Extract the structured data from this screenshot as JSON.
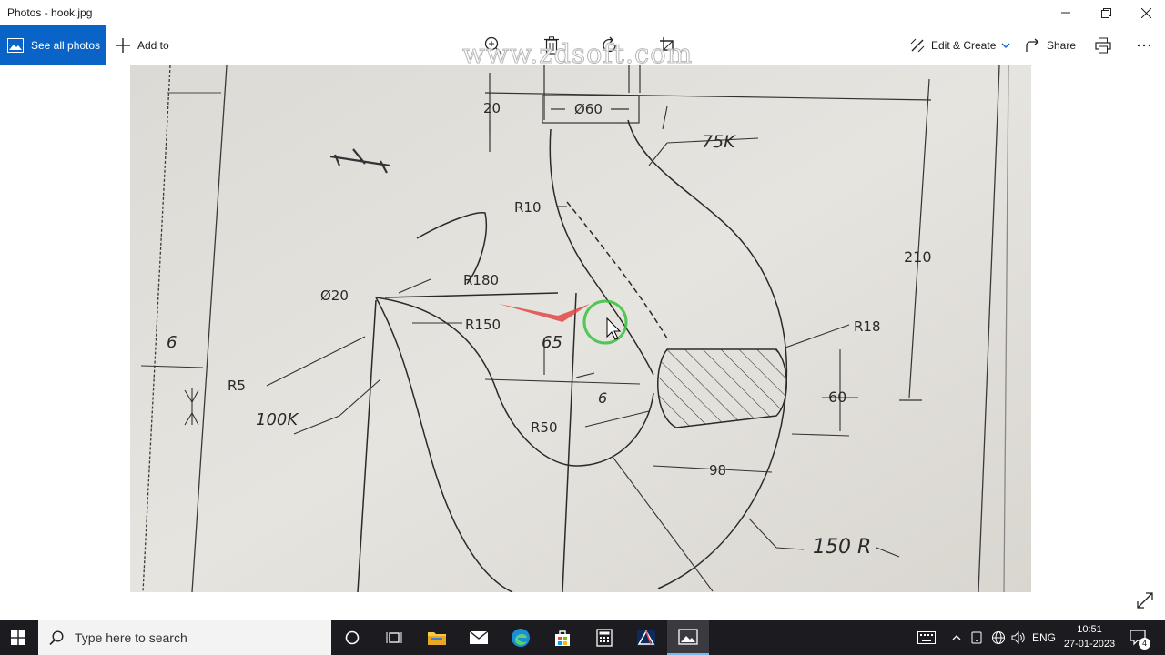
{
  "window": {
    "title": "Photos - hook.jpg",
    "minimize_icon": "minimize-icon",
    "maximize_icon": "restore-icon",
    "close_icon": "close-icon"
  },
  "toolbar": {
    "see_all_label": "See all photos",
    "add_to_label": "Add to",
    "edit_create_label": "Edit & Create",
    "share_label": "Share",
    "watermark": "www.zdsoft.com",
    "center_icons": [
      "zoom-in-icon",
      "delete-icon",
      "rotate-icon",
      "crop-icon"
    ]
  },
  "drawing": {
    "labels": {
      "d20": "20",
      "dia60": "Ø60",
      "r75": "75K",
      "r10": "R10",
      "d210": "210",
      "r180": "R180",
      "dia20": "Ø20",
      "r150": "R150",
      "d65": "65",
      "d6": "6",
      "r5": "R5",
      "r18": "R18",
      "d60": "60",
      "r100": "100K",
      "d6b": "6",
      "r50": "R50",
      "d98": "98",
      "r150b": "150 R"
    }
  },
  "taskbar": {
    "search_placeholder": "Type here to search",
    "language": "ENG",
    "time": "10:51",
    "date": "27-01-2023",
    "notification_count": "4"
  },
  "colors": {
    "accent": "#0a64c8",
    "taskbar": "#1c1c20",
    "paper": "#e3e1dc",
    "cursor_ring": "#36c23c"
  }
}
